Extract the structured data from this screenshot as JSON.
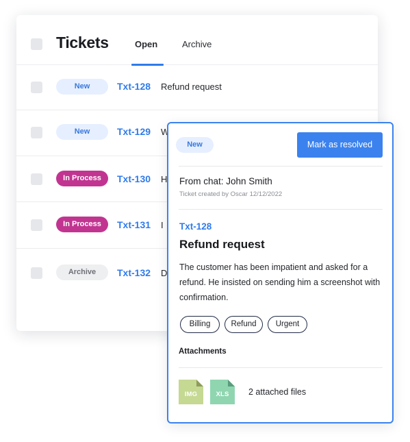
{
  "header": {
    "title": "Tickets",
    "tabs": [
      {
        "label": "Open",
        "active": true
      },
      {
        "label": "Archive",
        "active": false
      }
    ]
  },
  "tickets": [
    {
      "status": "New",
      "id": "Txt-128",
      "subject": "Refund request"
    },
    {
      "status": "New",
      "id": "Txt-129",
      "subject": "W"
    },
    {
      "status": "In Process",
      "id": "Txt-130",
      "subject": "H"
    },
    {
      "status": "In Process",
      "id": "Txt-131",
      "subject": "I"
    },
    {
      "status": "Archive",
      "id": "Txt-132",
      "subject": "D"
    }
  ],
  "detail": {
    "status": "New",
    "resolve_label": "Mark as resolved",
    "from": "From chat: John Smith",
    "meta": "Ticket created by Oscar 12/12/2022",
    "id": "Txt-128",
    "subject": "Refund request",
    "description": "The customer has been impatient and asked for a refund. He insisted on sending him a screenshot with confirmation.",
    "tags": [
      "Billing",
      "Refund",
      "Urgent"
    ],
    "attachments_label": "Attachments",
    "files": [
      {
        "type": "IMG",
        "icon": "img-file-icon",
        "color": "#c5d992"
      },
      {
        "type": "XLS",
        "icon": "xls-file-icon",
        "color": "#8fd6b0"
      }
    ],
    "attachments_count": "2 attached files"
  },
  "colors": {
    "accent": "#3b82ee",
    "badge_new_bg": "#e6efff",
    "badge_process_bg": "#c13591",
    "badge_archive_bg": "#eeeff1"
  }
}
